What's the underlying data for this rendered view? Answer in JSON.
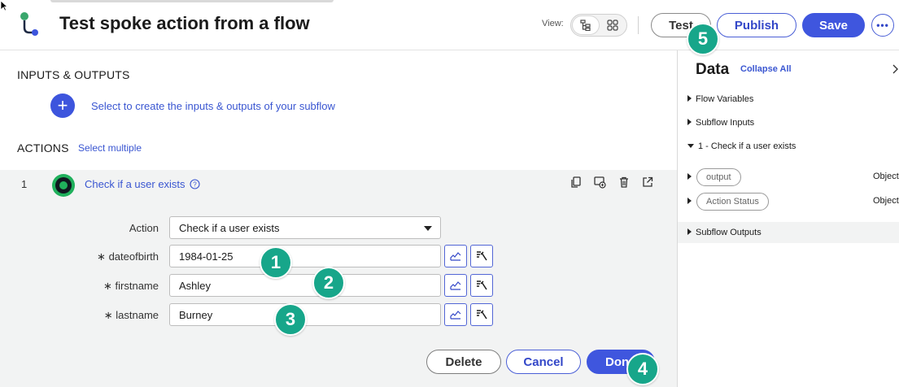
{
  "header": {
    "title": "Test spoke action from a flow",
    "view_label": "View:",
    "buttons": {
      "test": "Test",
      "publish": "Publish",
      "save": "Save",
      "more": "•••"
    }
  },
  "inputs_outputs": {
    "title": "INPUTS & OUTPUTS",
    "add_link": "Select to create the inputs & outputs of your subflow"
  },
  "actions": {
    "title": "ACTIONS",
    "select_multiple": "Select multiple",
    "items": [
      {
        "number": "1",
        "name": "Check if a user exists",
        "action_label": "Action",
        "action_value": "Check if a user exists",
        "fields": [
          {
            "label": "dateofbirth",
            "value": "1984-01-25",
            "required_mark": "∗"
          },
          {
            "label": "firstname",
            "value": "Ashley",
            "required_mark": "∗"
          },
          {
            "label": "lastname",
            "value": "Burney",
            "required_mark": "∗"
          }
        ]
      }
    ],
    "buttons": {
      "delete": "Delete",
      "cancel": "Cancel",
      "done": "Done"
    }
  },
  "data_panel": {
    "title": "Data",
    "collapse_all": "Collapse All",
    "tree": {
      "flow_variables": "Flow Variables",
      "subflow_inputs": "Subflow Inputs",
      "step1": "1 - Check if a user exists",
      "step1_children": [
        {
          "name": "output",
          "type": "Object"
        },
        {
          "name": "Action Status",
          "type": "Object"
        }
      ],
      "subflow_outputs": "Subflow Outputs"
    }
  },
  "badges": [
    "1",
    "2",
    "3",
    "4",
    "5"
  ],
  "colors": {
    "primary": "#3f56de",
    "link": "#3a56d1",
    "badge": "#17a68a",
    "panel_bg": "#f2f3f3"
  }
}
